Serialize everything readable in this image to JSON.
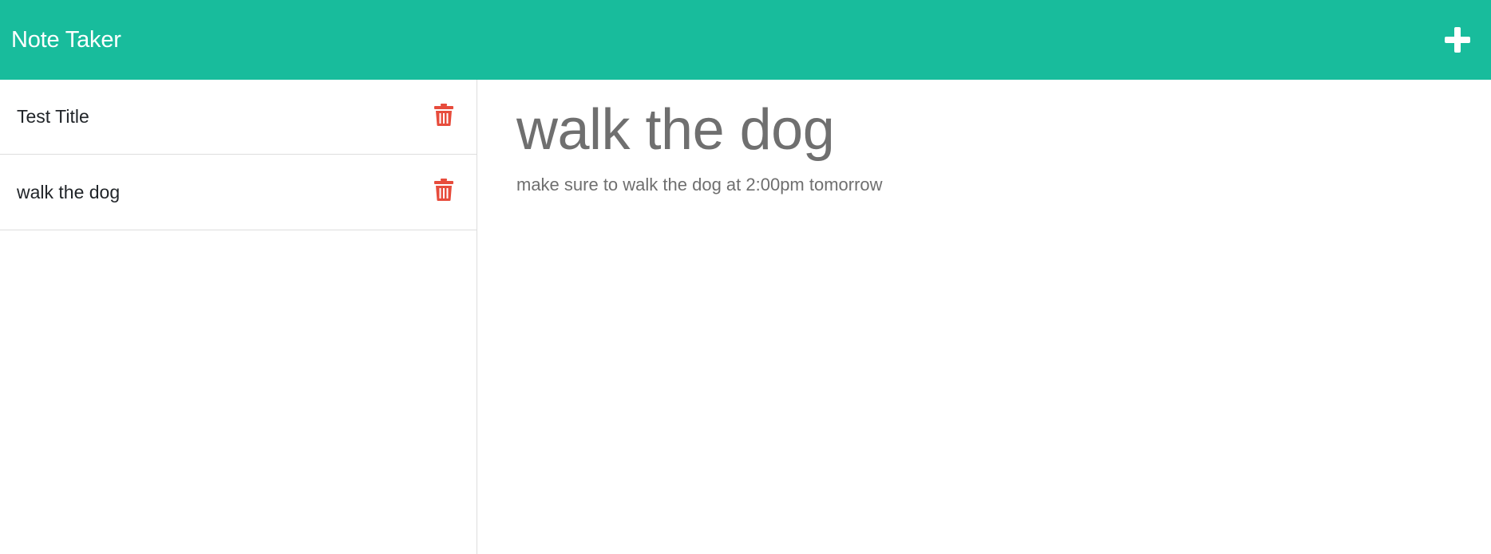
{
  "app": {
    "title": "Note Taker",
    "accent_color": "#18bc9c",
    "delete_color": "#e74c3c"
  },
  "header": {
    "add_icon": "plus-icon"
  },
  "sidebar": {
    "notes": [
      {
        "title": "Test Title",
        "icon": "trash-icon"
      },
      {
        "title": "walk the dog",
        "icon": "trash-icon"
      }
    ]
  },
  "main": {
    "note_title": "walk the dog",
    "note_text": "make sure to walk the dog at 2:00pm tomorrow"
  }
}
